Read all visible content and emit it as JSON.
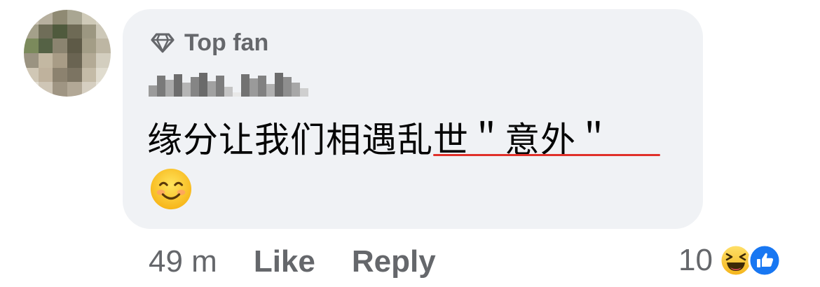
{
  "comment": {
    "badge_label": "Top fan",
    "badge_icon": "diamond-icon",
    "text": "缘分让我们相遇乱世＂意外＂",
    "emoji": "smiling-face-icon"
  },
  "actions": {
    "time": "49 m",
    "like_label": "Like",
    "reply_label": "Reply"
  },
  "reactions": {
    "count": "10",
    "icons": [
      "laughing-face-icon",
      "thumbs-up-icon"
    ]
  },
  "colors": {
    "bubble_bg": "#f0f2f5",
    "secondary_text": "#65676b",
    "primary_text": "#050505",
    "like_blue": "#1877f2",
    "spell_underline": "#e0302a"
  }
}
